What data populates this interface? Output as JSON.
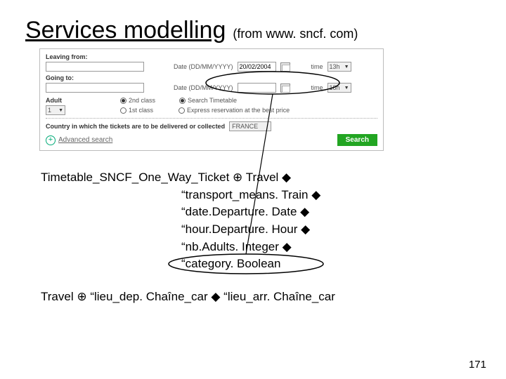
{
  "title": "Services modelling",
  "source": "(from www. sncf. com)",
  "form": {
    "leaving_label": "Leaving from:",
    "going_label": "Going to:",
    "date_label": "Date (DD/MM/YYYY)",
    "date_value": "20/02/2004",
    "time_label": "time",
    "time1_value": "13h",
    "time2_value": "18h",
    "adult_label": "Adult",
    "adult_value": "1",
    "class2_label": "2nd class",
    "class1_label": "1st class",
    "search_tt_label": "Search Timetable",
    "express_label": "Express reservation at the best price",
    "country_label": "Country in which the tickets are to be delivered or collected",
    "country_value": "FRANCE",
    "adv_label": "Advanced search",
    "search_btn": "Search"
  },
  "model": {
    "line1_prefix": "Timetable_SNCF_One_Way_Ticket ",
    "line1_suffix": " Travel ",
    "item1": "transport_means. Train ",
    "item2": "date.Departure. Date ",
    "item3": "hour.Departure. Hour ",
    "item4": "nb.Adults. Integer ",
    "item5": "category. Boolean",
    "line2_a": "Travel ",
    "line2_b": "lieu_dep. Chaîne_car ",
    "line2_c": "lieu_arr. Chaîne_car"
  },
  "glyph": {
    "quote": "“",
    "diamond": "◆",
    "clock": "⊕"
  },
  "page": "171"
}
